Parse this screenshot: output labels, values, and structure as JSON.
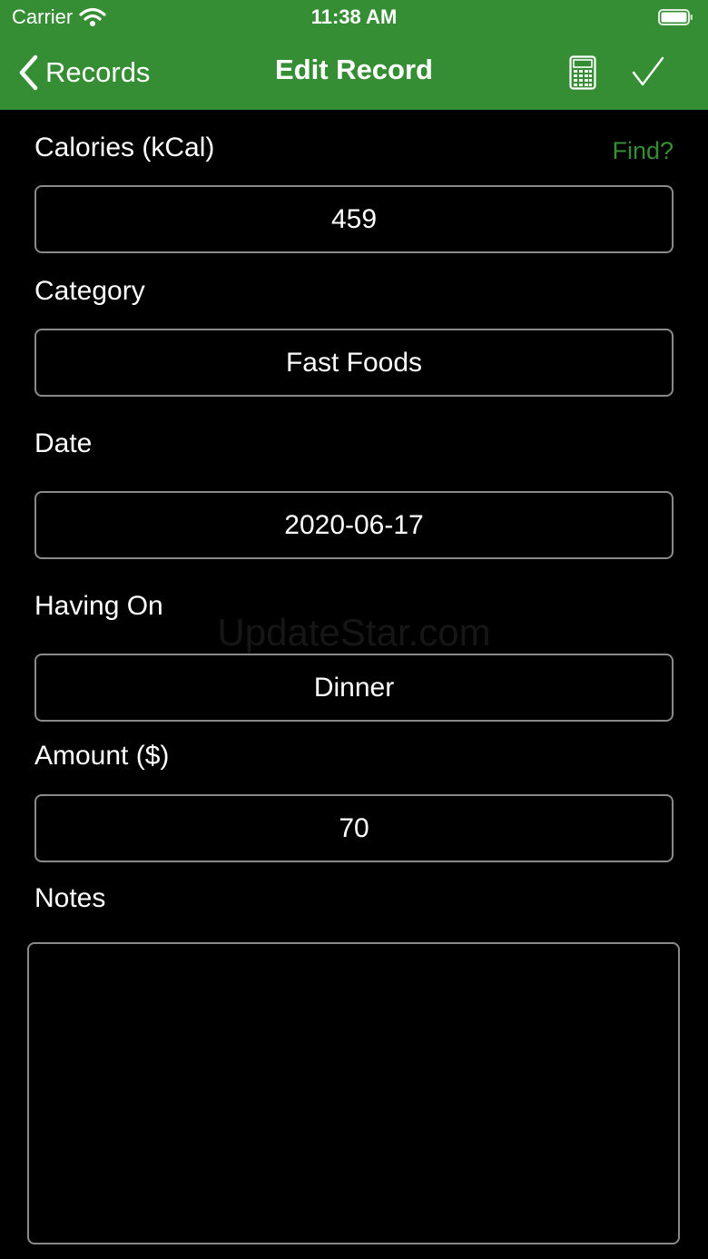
{
  "status_bar": {
    "carrier": "Carrier",
    "time": "11:38 AM",
    "wifi_icon": "wifi-icon",
    "battery_icon": "battery-icon",
    "battery_level": 1.0
  },
  "nav": {
    "back_label": "Records",
    "back_icon": "chevron-left-icon",
    "title": "Edit Record",
    "calculator_icon": "calculator-icon",
    "done_icon": "checkmark-icon"
  },
  "form": {
    "calories": {
      "label": "Calories (kCal)",
      "value": "459",
      "find_label": "Find?"
    },
    "category": {
      "label": "Category",
      "value": "Fast Foods"
    },
    "date": {
      "label": "Date",
      "value": "2020-06-17"
    },
    "having_on": {
      "label": "Having On",
      "value": "Dinner"
    },
    "amount": {
      "label": "Amount ($)",
      "value": "70"
    },
    "notes": {
      "label": "Notes",
      "value": ""
    }
  },
  "watermark": "UpdateStar.com",
  "colors": {
    "accent": "#368E34",
    "background": "#000000",
    "field_border": "#8a8a8a",
    "text": "#ffffff"
  }
}
